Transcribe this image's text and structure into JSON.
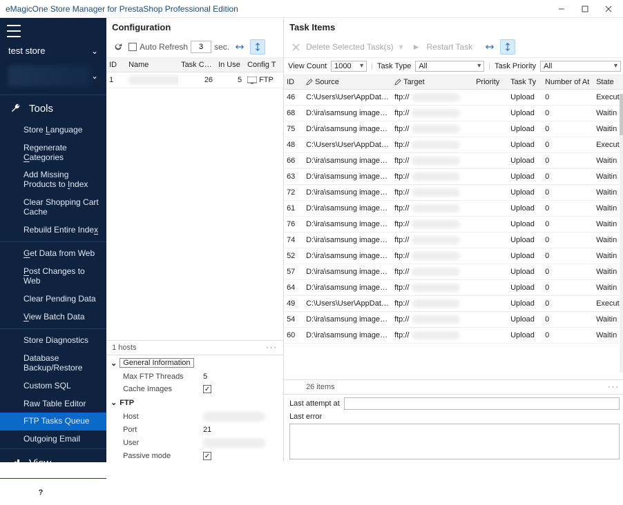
{
  "window": {
    "title": "eMagicOne Store Manager for PrestaShop Professional Edition"
  },
  "sidebar": {
    "store_name": "test store",
    "tools_label": "Tools",
    "view_label": "View",
    "items": [
      {
        "label_pre": "Store ",
        "label_u": "L",
        "label_post": "anguage"
      },
      {
        "label_pre": "Regenerate ",
        "label_u": "C",
        "label_post": "ategories"
      },
      {
        "label_pre": "Add Missing Products to ",
        "label_u": "I",
        "label_post": "ndex"
      },
      {
        "label_pre": "Clear Shopping Cart Cache",
        "label_u": "",
        "label_post": ""
      },
      {
        "label_pre": "Rebuild Entire Inde",
        "label_u": "x",
        "label_post": ""
      },
      {
        "label_pre": "",
        "label_u": "G",
        "label_post": "et Data from Web"
      },
      {
        "label_pre": "",
        "label_u": "P",
        "label_post": "ost Changes to Web"
      },
      {
        "label_pre": "Clear Pending Data",
        "label_u": "",
        "label_post": ""
      },
      {
        "label_pre": "",
        "label_u": "V",
        "label_post": "iew Batch Data"
      },
      {
        "label_pre": "Store Diagnostics",
        "label_u": "",
        "label_post": ""
      },
      {
        "label_pre": "Database Backup/Restore",
        "label_u": "",
        "label_post": ""
      },
      {
        "label_pre": "Custom SQL",
        "label_u": "",
        "label_post": ""
      },
      {
        "label_pre": "Raw Table Editor",
        "label_u": "",
        "label_post": ""
      },
      {
        "label_pre": "FTP Tasks Queue",
        "label_u": "",
        "label_post": "",
        "active": true
      },
      {
        "label_pre": "Outgoing Email",
        "label_u": "",
        "label_post": ""
      }
    ]
  },
  "config": {
    "title": "Configuration",
    "auto_refresh_label": "Auto Refresh",
    "auto_refresh_value": "3",
    "sec_label": "sec.",
    "columns": {
      "id": "ID",
      "name": "Name",
      "task": "Task Cour",
      "inuse": "In Use",
      "cfgt": "Config T"
    },
    "row": {
      "id": "1",
      "name": "",
      "task": "26",
      "inuse": "5",
      "cfgt": "FTP"
    },
    "status": "1 hosts",
    "gi_label": "General Information",
    "max_ftp_label": "Max FTP Threads",
    "max_ftp_value": "5",
    "cache_images_label": "Cache Images",
    "ftp_label": "FTP",
    "host_label": "Host",
    "port_label": "Port",
    "port_value": "21",
    "user_label": "User",
    "passive_label": "Passive mode"
  },
  "tasks": {
    "title": "Task Items",
    "delete_label": "Delete Selected Task(s)",
    "restart_label": "Restart Task",
    "view_count_label": "View Count",
    "view_count_value": "1000",
    "task_type_label": "Task Type",
    "task_type_value": "All",
    "task_priority_label": "Task Priority",
    "task_priority_value": "All",
    "columns": {
      "id": "ID",
      "source": "Source",
      "target": "Target",
      "priority": "Priority",
      "ttype": "Task Ty",
      "natt": "Number of At",
      "state": "State"
    },
    "target_prefix": "ftp://",
    "rows": [
      {
        "id": "46",
        "source": "C:\\Users\\User\\AppData\\L",
        "type": "Upload",
        "att": "0",
        "state": "Executi"
      },
      {
        "id": "68",
        "source": "D:\\ira\\samsung images\\p",
        "type": "Upload",
        "att": "0",
        "state": "Waitin"
      },
      {
        "id": "75",
        "source": "D:\\ira\\samsung images\\p",
        "type": "Upload",
        "att": "0",
        "state": "Waitin"
      },
      {
        "id": "48",
        "source": "C:\\Users\\User\\AppData\\L",
        "type": "Upload",
        "att": "0",
        "state": "Executi"
      },
      {
        "id": "66",
        "source": "D:\\ira\\samsung images\\p",
        "type": "Upload",
        "att": "0",
        "state": "Waitin"
      },
      {
        "id": "63",
        "source": "D:\\ira\\samsung images\\p",
        "type": "Upload",
        "att": "0",
        "state": "Waitin"
      },
      {
        "id": "72",
        "source": "D:\\ira\\samsung images\\p",
        "type": "Upload",
        "att": "0",
        "state": "Waitin"
      },
      {
        "id": "61",
        "source": "D:\\ira\\samsung images\\p",
        "type": "Upload",
        "att": "0",
        "state": "Waitin"
      },
      {
        "id": "76",
        "source": "D:\\ira\\samsung images\\p",
        "type": "Upload",
        "att": "0",
        "state": "Waitin"
      },
      {
        "id": "74",
        "source": "D:\\ira\\samsung images\\p",
        "type": "Upload",
        "att": "0",
        "state": "Waitin"
      },
      {
        "id": "52",
        "source": "D:\\ira\\samsung images\\p",
        "type": "Upload",
        "att": "0",
        "state": "Waitin"
      },
      {
        "id": "57",
        "source": "D:\\ira\\samsung images\\p",
        "type": "Upload",
        "att": "0",
        "state": "Waitin"
      },
      {
        "id": "64",
        "source": "D:\\ira\\samsung images\\p",
        "type": "Upload",
        "att": "0",
        "state": "Waitin"
      },
      {
        "id": "49",
        "source": "C:\\Users\\User\\AppData\\L",
        "type": "Upload",
        "att": "0",
        "state": "Executi"
      },
      {
        "id": "54",
        "source": "D:\\ira\\samsung images\\p",
        "type": "Upload",
        "att": "0",
        "state": "Waitin"
      },
      {
        "id": "60",
        "source": "D:\\ira\\samsung images\\p",
        "type": "Upload",
        "att": "0",
        "state": "Waitin"
      }
    ],
    "count_status": "26 items",
    "last_attempt_label": "Last attempt at",
    "last_error_label": "Last error"
  }
}
